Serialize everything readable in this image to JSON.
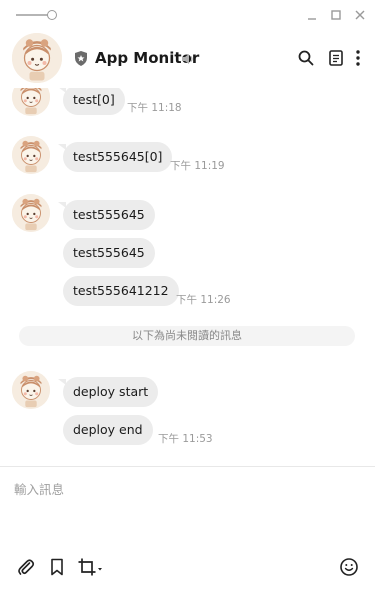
{
  "header": {
    "title": "App Monitor",
    "icons": [
      "shield-icon",
      "mute-icon",
      "search-icon",
      "notes-icon",
      "more-icon"
    ]
  },
  "window": {
    "controls": [
      "opacity-slider",
      "minimize-icon",
      "maximize-icon",
      "close-icon"
    ]
  },
  "messages": [
    {
      "text": "test[0]",
      "time": "下午 11:18"
    },
    {
      "text": "test555645[0]",
      "time": "下午 11:19"
    },
    {
      "text": "test555645",
      "time": ""
    },
    {
      "text": "test555645",
      "time": ""
    },
    {
      "text": "test555641212",
      "time": "下午 11:26"
    },
    {
      "text": "deploy start",
      "time": ""
    },
    {
      "text": "deploy end",
      "time": "下午 11:53"
    }
  ],
  "unread_divider": "以下為尚未閱讀的訊息",
  "composer": {
    "placeholder": "輸入訊息",
    "tools": [
      "paperclip-icon",
      "bookmark-icon",
      "crop-icon",
      "emoji-icon"
    ]
  },
  "colors": {
    "bubble": "#ececec",
    "timestamp": "#9a9a9a",
    "background": "#ffffff"
  }
}
